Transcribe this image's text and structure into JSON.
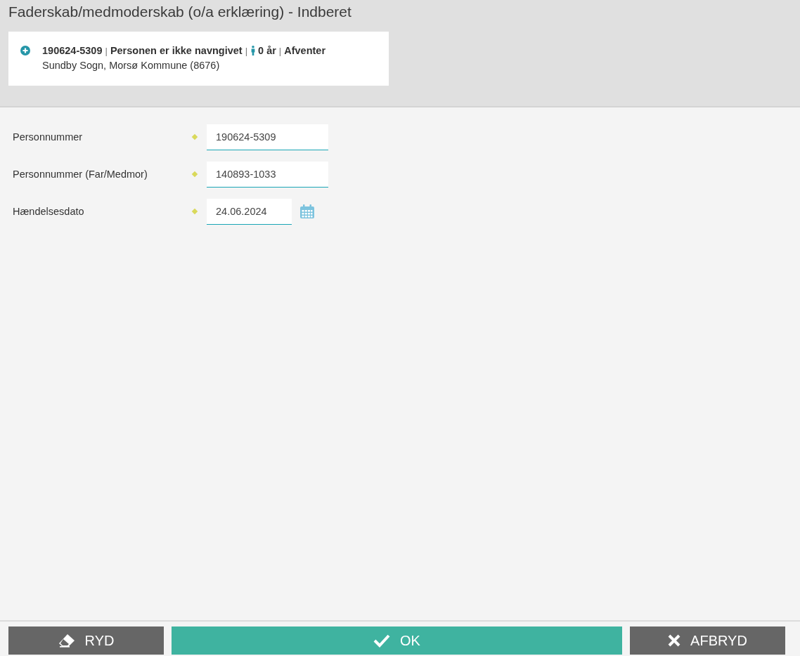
{
  "window": {
    "title": "Faderskab/medmoderskab (o/a erklæring) - Indberet"
  },
  "summary": {
    "line": [
      {
        "kind": "text",
        "text": "190624-5309"
      },
      {
        "kind": "sep",
        "text": "|"
      },
      {
        "kind": "text",
        "text": "Personen er ikke navngivet"
      },
      {
        "kind": "sep",
        "text": "|"
      },
      {
        "kind": "age",
        "text": "0 år"
      },
      {
        "kind": "sep",
        "text": "|"
      },
      {
        "kind": "text",
        "text": "Afventer"
      }
    ],
    "location": "Sundby Sogn, Morsø Kommune (8676)"
  },
  "fields": [
    {
      "kind": "text",
      "label": "Personnummer",
      "required": true,
      "value": "190624-5309"
    },
    {
      "kind": "text",
      "label": "Personnummer (Far/Medmor)",
      "required": true,
      "value": "140893-1033"
    },
    {
      "kind": "date",
      "label": "Hændelsesdato",
      "required": true,
      "value": "24.06.2024"
    }
  ],
  "buttons": [
    {
      "kind": "clear",
      "label": "RYD",
      "primary": false
    },
    {
      "kind": "ok",
      "label": "OK",
      "primary": true
    },
    {
      "kind": "cancel",
      "label": "AFBRYD",
      "primary": false
    }
  ]
}
